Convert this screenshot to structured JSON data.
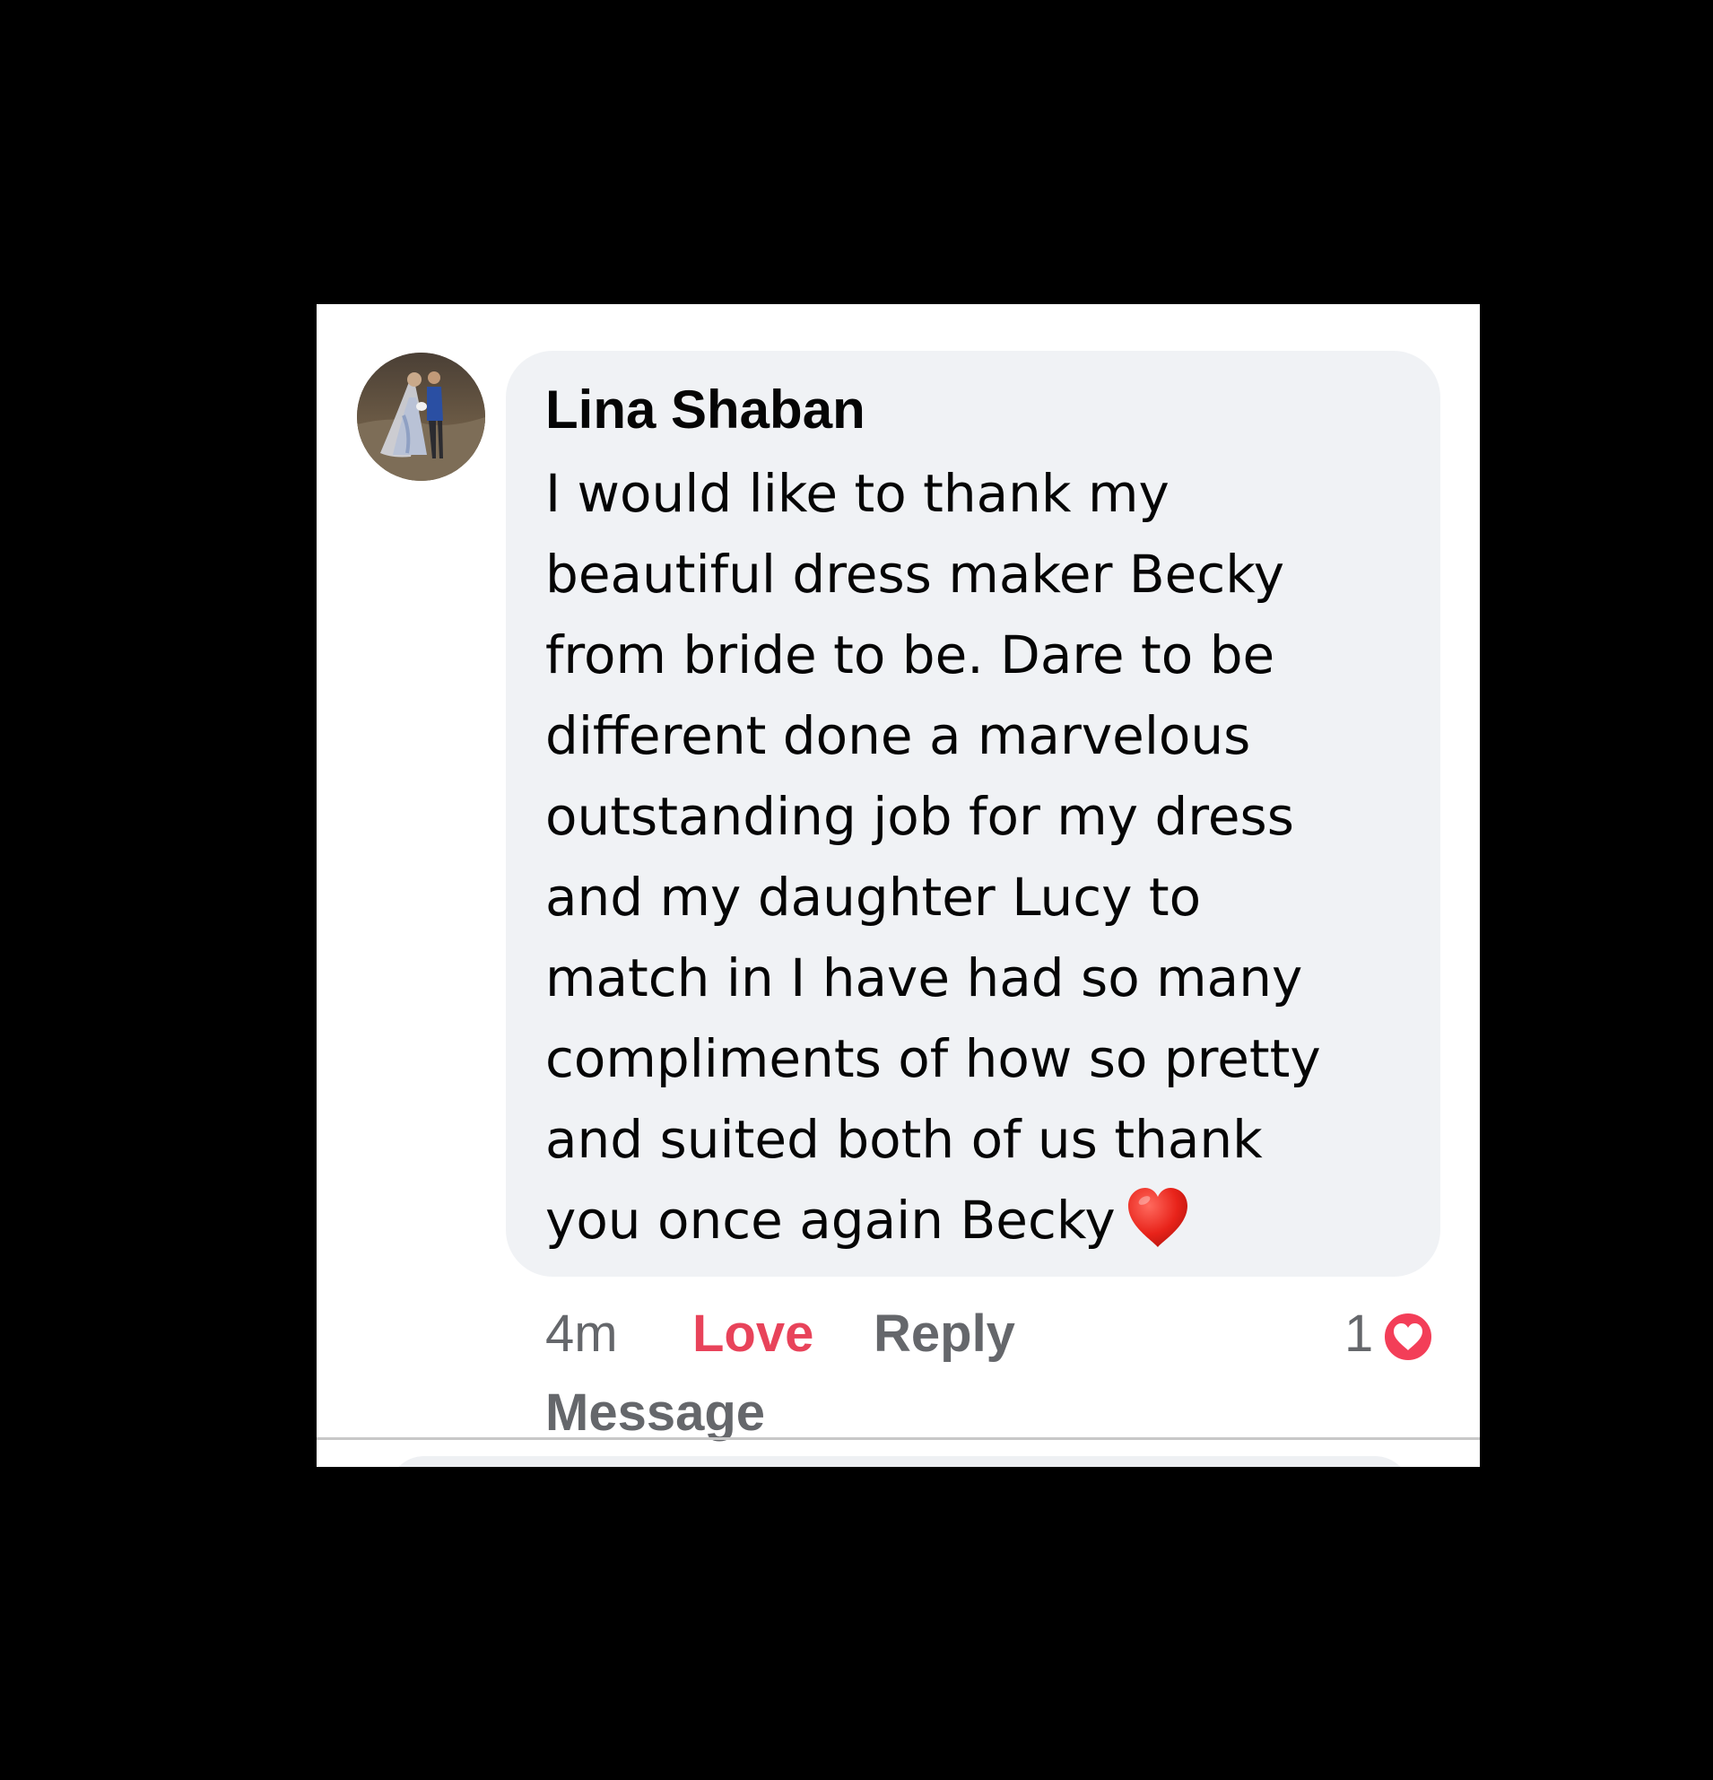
{
  "colors": {
    "page_background": "#000000",
    "card_background": "#ffffff",
    "bubble_background": "#f0f2f5",
    "text_primary": "#050505",
    "text_secondary": "#65676b",
    "love_accent": "#e8435a"
  },
  "comment": {
    "author": "Lina Shaban",
    "avatar_icon": "profile-photo-wedding-couple",
    "lines": [
      "I would like to thank my",
      "beautiful dress maker Becky",
      "from bride to be. Dare to be",
      "different done a marvelous",
      "outstanding job for my dress",
      "and my daughter Lucy to",
      "match in I have had so many",
      "compliments of how so pretty",
      "and suited both of us thank",
      "you once again Becky"
    ],
    "trailing_emoji": "red-heart-emoji"
  },
  "actions": {
    "time": "4m",
    "love_label": "Love",
    "reply_label": "Reply",
    "message_label": "Message"
  },
  "reactions": {
    "count": "1",
    "icon": "love-reaction-icon"
  }
}
